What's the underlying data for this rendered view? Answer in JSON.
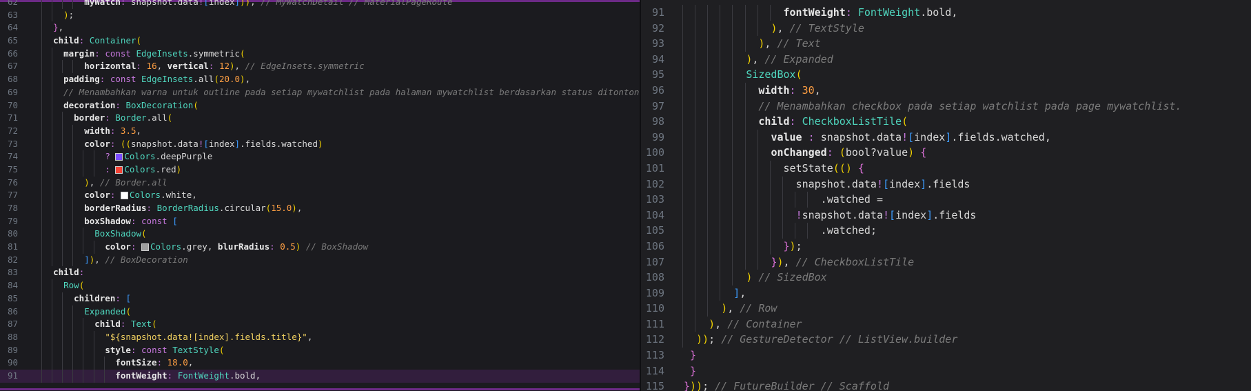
{
  "left_editor": {
    "lines": [
      {
        "n": "62",
        "t": "        myWatch: snapshot.data![index])), // MyWatchDetail // MaterialPageRoute"
      },
      {
        "n": "63",
        "t": "    );"
      },
      {
        "n": "64",
        "t": "  },"
      },
      {
        "n": "65",
        "t": "  child: Container("
      },
      {
        "n": "66",
        "t": "    margin: const EdgeInsets.symmetric("
      },
      {
        "n": "67",
        "t": "        horizontal: 16, vertical: 12), // EdgeInsets.symmetric"
      },
      {
        "n": "68",
        "t": "    padding: const EdgeInsets.all(20.0),"
      },
      {
        "n": "69",
        "t": "    // Menambahkan warna untuk outline pada setiap mywatchlist pada halaman mywatchlist berdasarkan status ditonton"
      },
      {
        "n": "70",
        "t": "    decoration: BoxDecoration("
      },
      {
        "n": "71",
        "t": "      border: Border.all("
      },
      {
        "n": "72",
        "t": "        width: 3.5,"
      },
      {
        "n": "73",
        "t": "        color: ((snapshot.data![index].fields.watched)"
      },
      {
        "n": "74",
        "t": "            ? ■Colors.deepPurple"
      },
      {
        "n": "75",
        "t": "            : ■Colors.red)"
      },
      {
        "n": "76",
        "t": "        ), // Border.all"
      },
      {
        "n": "77",
        "t": "        color: ■Colors.white,"
      },
      {
        "n": "78",
        "t": "        borderRadius: BorderRadius.circular(15.0),"
      },
      {
        "n": "79",
        "t": "        boxShadow: const ["
      },
      {
        "n": "80",
        "t": "          BoxShadow("
      },
      {
        "n": "81",
        "t": "            color: ■Colors.grey, blurRadius: 0.5) // BoxShadow"
      },
      {
        "n": "82",
        "t": "        ]), // BoxDecoration"
      },
      {
        "n": "83",
        "t": "  child:"
      },
      {
        "n": "84",
        "t": "    Row("
      },
      {
        "n": "85",
        "t": "      children: ["
      },
      {
        "n": "86",
        "t": "        Expanded("
      },
      {
        "n": "87",
        "t": "          child: Text("
      },
      {
        "n": "88",
        "t": "            \"${snapshot.data![index].fields.title}\","
      },
      {
        "n": "89",
        "t": "            style: const TextStyle("
      },
      {
        "n": "90",
        "t": "              fontSize: 18.0,"
      },
      {
        "n": "91",
        "t": "              fontWeight: FontWeight.bold,"
      }
    ],
    "swatches": {
      "deepPurple": "#7c4dff",
      "red": "#f44336",
      "white": "#ffffff",
      "grey": "#9e9e9e"
    }
  },
  "right_editor": {
    "lines": [
      {
        "n": "91",
        "t": "                fontWeight: FontWeight.bold,"
      },
      {
        "n": "92",
        "t": "              ), // TextStyle"
      },
      {
        "n": "93",
        "t": "            ), // Text"
      },
      {
        "n": "94",
        "t": "          ), // Expanded"
      },
      {
        "n": "95",
        "t": "          SizedBox("
      },
      {
        "n": "96",
        "t": "            width: 30,"
      },
      {
        "n": "97",
        "t": "            // Menambahkan checkbox pada setiap watchlist pada page mywatchlist."
      },
      {
        "n": "98",
        "t": "            child: CheckboxListTile("
      },
      {
        "n": "99",
        "t": "              value : snapshot.data![index].fields.watched,"
      },
      {
        "n": "100",
        "t": "              onChanged: (bool?value) {"
      },
      {
        "n": "101",
        "t": "                setState(() {"
      },
      {
        "n": "102",
        "t": "                  snapshot.data![index].fields"
      },
      {
        "n": "103",
        "t": "                      .watched ="
      },
      {
        "n": "104",
        "t": "                  !snapshot.data![index].fields"
      },
      {
        "n": "105",
        "t": "                      .watched;"
      },
      {
        "n": "106",
        "t": "                });"
      },
      {
        "n": "107",
        "t": "              }), // CheckboxListTile"
      },
      {
        "n": "108",
        "t": "          ) // SizedBox"
      },
      {
        "n": "109",
        "t": "        ],"
      },
      {
        "n": "110",
        "t": "      ), // Row"
      },
      {
        "n": "111",
        "t": "    ), // Container"
      },
      {
        "n": "112",
        "t": "  )); // GestureDetector // ListView.builder"
      },
      {
        "n": "113",
        "t": " }"
      },
      {
        "n": "114",
        "t": " }"
      },
      {
        "n": "115",
        "t": "})); // FutureBuilder // Scaffold"
      }
    ]
  }
}
